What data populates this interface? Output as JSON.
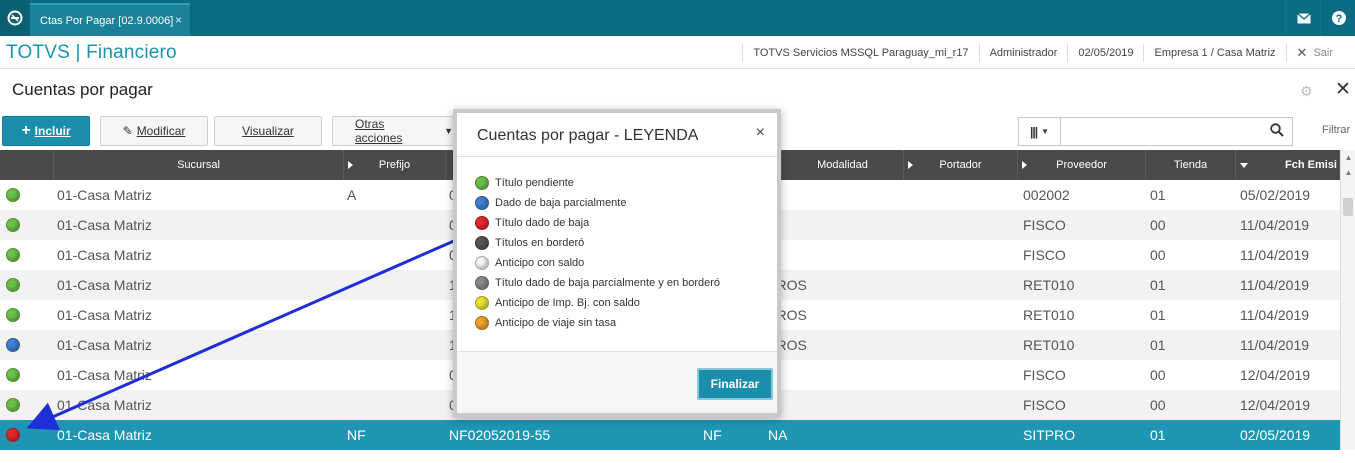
{
  "window": {
    "tab_label": "Ctas Por Pagar [02.9.0006]",
    "tab_close": "×"
  },
  "header": {
    "brand": "TOTVS | Financiero",
    "environment": "TOTVS Servicios MSSQL Paraguay_mi_r17",
    "user": "Administrador",
    "date": "02/05/2019",
    "company": "Empresa 1 / Casa Matriz",
    "exit_label": "Sair"
  },
  "page": {
    "title": "Cuentas por pagar"
  },
  "toolbar": {
    "include_label": "Incluir",
    "modify_label": "Modificar",
    "view_label": "Visualizar",
    "other_label": "Otras acciones",
    "filter_label": "Filtrar",
    "search_value": ""
  },
  "grid": {
    "columns": [
      "",
      "Sucursal",
      "Prefijo",
      "",
      "",
      "Modalidad",
      "Portador",
      "Proveedor",
      "Tienda",
      "Fch Emisi"
    ],
    "rows": [
      {
        "status": "green",
        "sucursal": "01-Casa Matriz",
        "prefijo": "A",
        "numero": "0",
        "tipo": "",
        "modalidad": "",
        "proveedor": "002002",
        "tienda": "01",
        "fecha": "05/02/2019"
      },
      {
        "status": "green",
        "sucursal": "01-Casa Matriz",
        "prefijo": "",
        "numero": "0",
        "tipo": "",
        "modalidad": "",
        "proveedor": "FISCO",
        "tienda": "00",
        "fecha": "11/04/2019"
      },
      {
        "status": "green",
        "sucursal": "01-Casa Matriz",
        "prefijo": "",
        "numero": "0",
        "tipo": "",
        "modalidad": "",
        "proveedor": "FISCO",
        "tienda": "00",
        "fecha": "11/04/2019"
      },
      {
        "status": "green",
        "sucursal": "01-Casa Matriz",
        "prefijo": "",
        "numero": "1",
        "tipo": "",
        "modalidad": "TROS",
        "proveedor": "RET010",
        "tienda": "01",
        "fecha": "11/04/2019"
      },
      {
        "status": "green",
        "sucursal": "01-Casa Matriz",
        "prefijo": "",
        "numero": "1",
        "tipo": "",
        "modalidad": "TROS",
        "proveedor": "RET010",
        "tienda": "01",
        "fecha": "11/04/2019"
      },
      {
        "status": "blue",
        "sucursal": "01-Casa Matriz",
        "prefijo": "",
        "numero": "1",
        "tipo": "",
        "modalidad": "TROS",
        "proveedor": "RET010",
        "tienda": "01",
        "fecha": "11/04/2019"
      },
      {
        "status": "green",
        "sucursal": "01-Casa Matriz",
        "prefijo": "",
        "numero": "0",
        "tipo": "",
        "modalidad": "",
        "proveedor": "FISCO",
        "tienda": "00",
        "fecha": "12/04/2019"
      },
      {
        "status": "green",
        "sucursal": "01-Casa Matriz",
        "prefijo": "",
        "numero": "0",
        "tipo": "",
        "modalidad": "",
        "proveedor": "FISCO",
        "tienda": "00",
        "fecha": "12/04/2019"
      },
      {
        "status": "red",
        "sucursal": "01-Casa Matriz",
        "prefijo": "NF",
        "numero": "NF02052019-55",
        "tipo": "NF",
        "modalidad": "NA",
        "proveedor": "SITPRO",
        "tienda": "01",
        "fecha": "02/05/2019"
      }
    ]
  },
  "legend_modal": {
    "title": "Cuentas por pagar - LEYENDA",
    "close": "×",
    "items": [
      {
        "color": "green",
        "label": "Título pendiente"
      },
      {
        "color": "blue",
        "label": "Dado de baja parcialmente"
      },
      {
        "color": "red",
        "label": "Título dado de baja"
      },
      {
        "color": "darkgray",
        "label": "Títulos en borderó"
      },
      {
        "color": "white",
        "label": "Anticipo con saldo"
      },
      {
        "color": "gray",
        "label": "Título dado de baja parcialmente y en borderó"
      },
      {
        "color": "yellow",
        "label": "Anticipo de Imp. Bj. con saldo"
      },
      {
        "color": "orange",
        "label": "Anticipo de viaje sin tasa"
      }
    ],
    "finish_label": "Finalizar"
  },
  "colors": {
    "green": "#6cc24a",
    "blue": "#3f7fd0",
    "red": "#e0282e",
    "darkgray": "#555555",
    "white": "#f2f2f2",
    "gray": "#8a8a8a",
    "yellow": "#e8e236",
    "orange": "#f0a12a",
    "arrow": "#1f2fd8"
  }
}
